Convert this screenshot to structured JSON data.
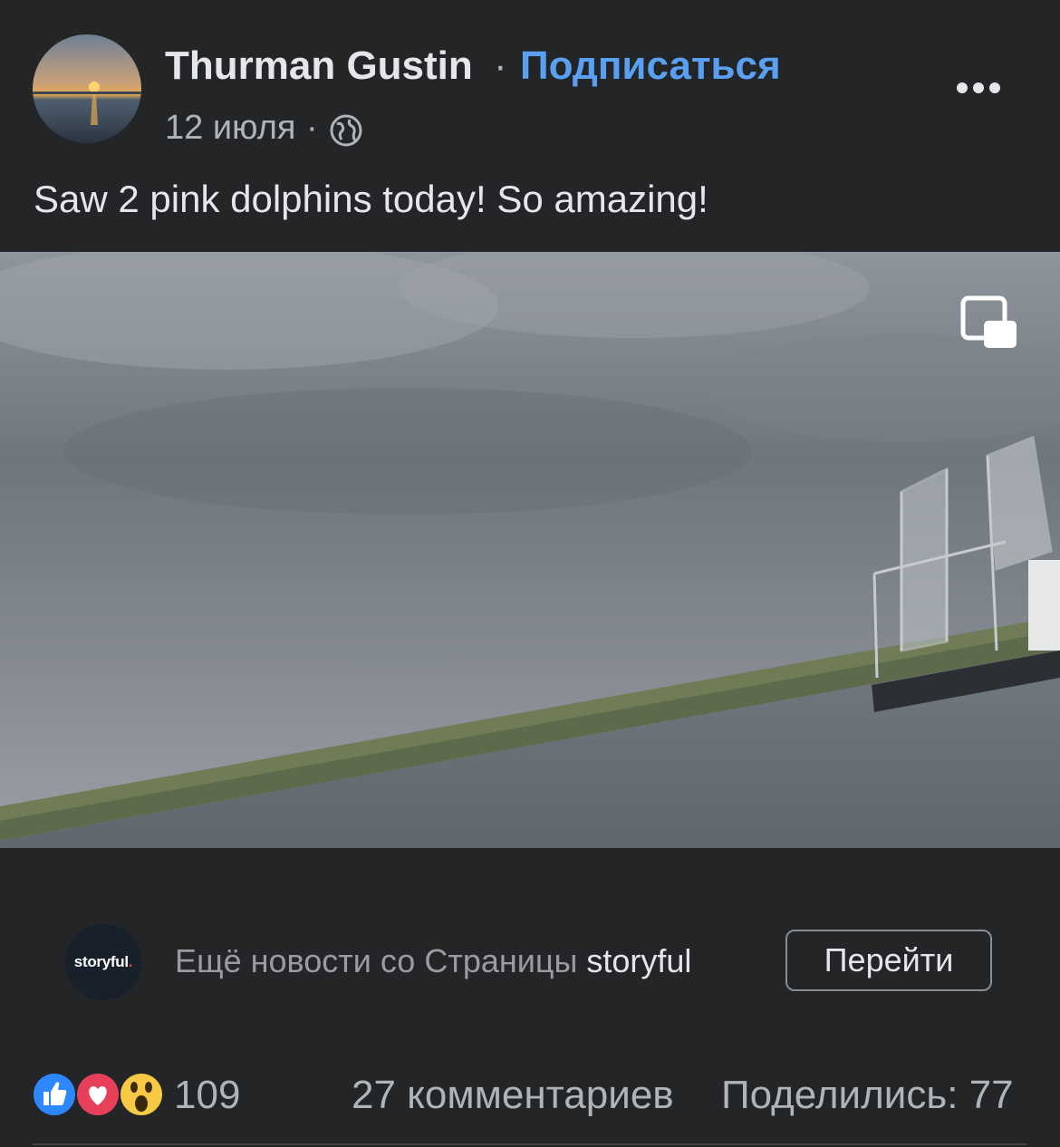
{
  "post": {
    "author": "Thurman Gustin",
    "separator": "·",
    "follow_label": "Подписаться",
    "date": "12 июля",
    "privacy_icon": "globe-icon",
    "more_icon": "more-options-icon",
    "text": "Saw 2 pink dolphins today! So amazing!"
  },
  "video": {
    "pip_icon": "picture-in-picture-icon"
  },
  "publisher": {
    "logo_text": "storyful",
    "logo_dot": ".",
    "more_news_prefix": "Ещё новости со Страницы",
    "page_name": "storyful",
    "goto_label": "Перейти"
  },
  "stats": {
    "reaction_icons": [
      "like-icon",
      "love-icon",
      "wow-icon"
    ],
    "reactions_count": "109",
    "comments": "27 комментариев",
    "shares": "Поделились: 77"
  },
  "colors": {
    "background": "#242526",
    "link_blue": "#5aa0f2",
    "text_primary": "#e4e6eb",
    "text_secondary": "#b0b3b8"
  }
}
